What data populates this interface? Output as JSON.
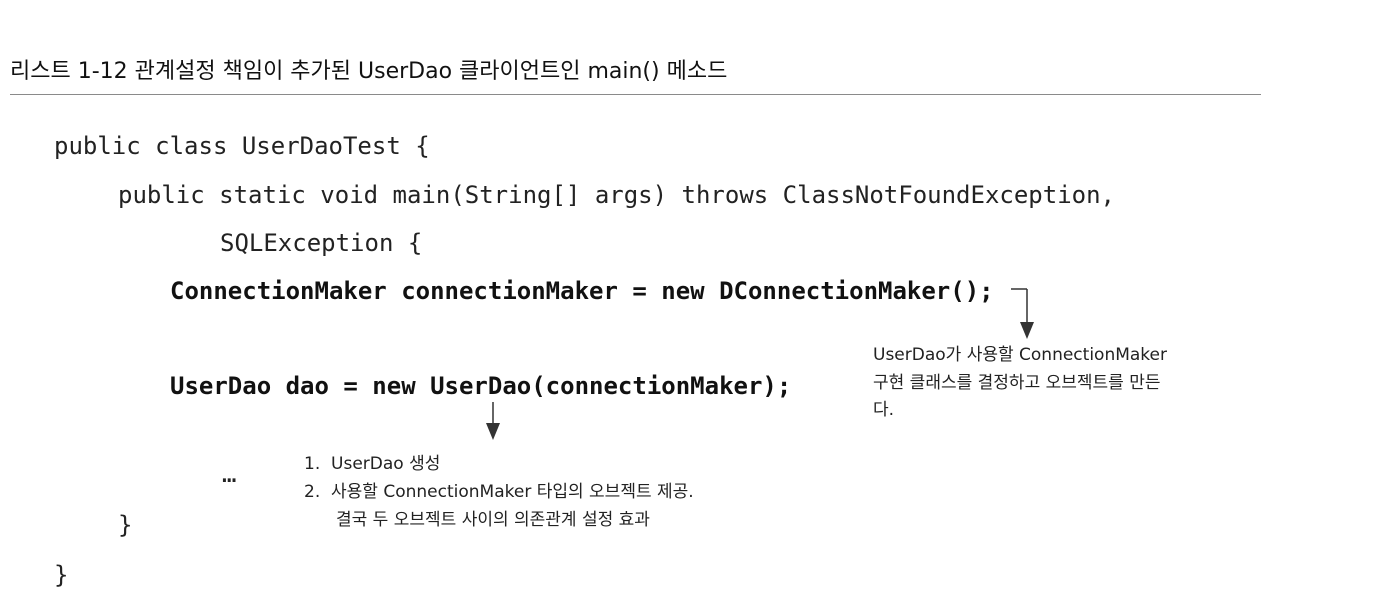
{
  "listing": {
    "caption": "리스트 1-12 관계설정 책임이 추가된 UserDao 클라이언트인 main() 메소드"
  },
  "code": {
    "line1": "public class UserDaoTest {",
    "line2": "public static void main(String[] args) throws ClassNotFoundException,",
    "line3": "SQLException {",
    "line4": "ConnectionMaker connectionMaker = new DConnectionMaker();",
    "line5": "UserDao dao = new UserDao(connectionMaker);",
    "line6": "…",
    "line7": "}",
    "line8": "}"
  },
  "notes": {
    "right_line1": "UserDao가 사용할 ConnectionMaker",
    "right_line2": "구현 클래스를 결정하고 오브젝트를 만든",
    "right_line3": "다.",
    "bottom_line1": "1.  UserDao 생성",
    "bottom_line2": "2.  사용할 ConnectionMaker 타입의 오브젝트 제공.",
    "bottom_line3": "결국 두 오브젝트 사이의 의존관계 설정 효과"
  }
}
